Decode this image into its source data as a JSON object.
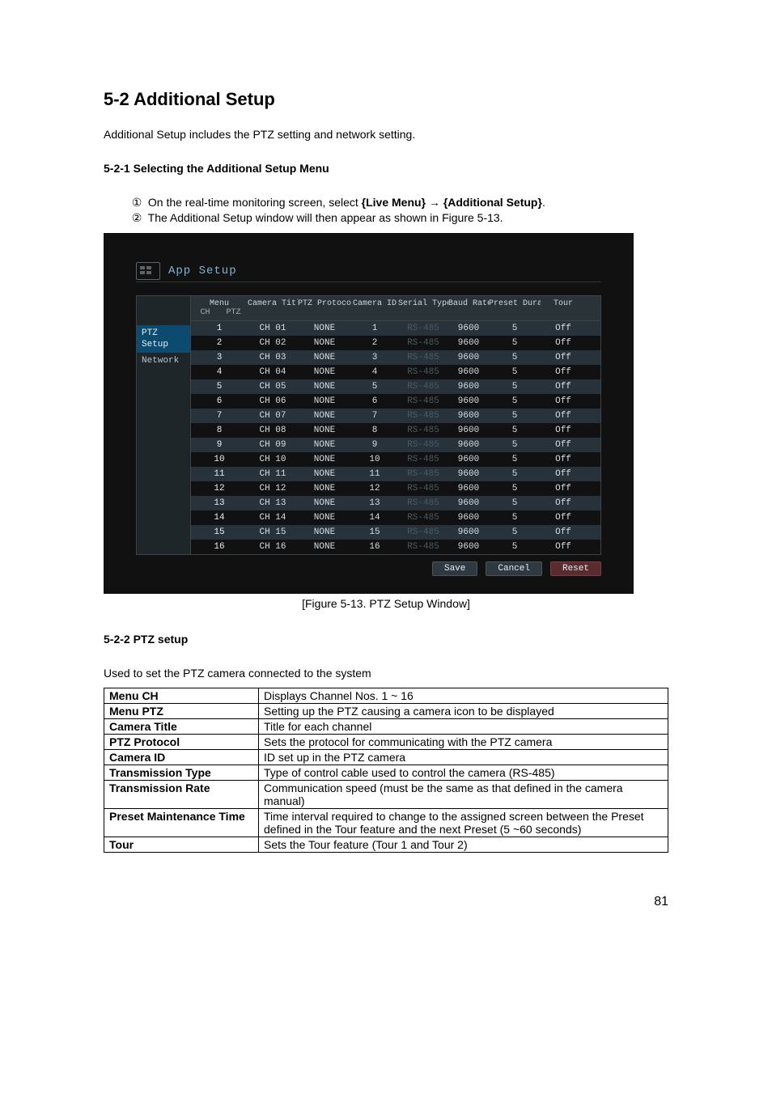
{
  "headings": {
    "main": "5-2  Additional Setup",
    "intro": "Additional Setup includes the PTZ setting and network setting.",
    "sub1": "5-2-1  Selecting the Additional Setup Menu",
    "sub2": "5-2-2  PTZ setup",
    "sub2_desc": "Used to set the PTZ camera connected to the system"
  },
  "steps": {
    "s1_pre": "On the real-time monitoring screen, select ",
    "s1_b1": "{Live Menu}",
    "s1_arrow": " → ",
    "s1_b2": "{Additional Setup}",
    "s1_post": ".",
    "s2": "The Additional Setup window will then appear as shown in Figure 5-13."
  },
  "app": {
    "title": "App Setup",
    "sidebar": {
      "item1a": "PTZ",
      "item1b": "Setup",
      "item2": "Network"
    },
    "headers": {
      "menu": "Menu",
      "menu_ch": "CH",
      "menu_ptz": "PTZ",
      "title": "Camera Title",
      "proto": "PTZ Protocol",
      "id": "Camera ID",
      "serial": "Serial Type",
      "baud": "Baud Rate",
      "preset": "Preset Duration",
      "tour": "Tour"
    },
    "rows": [
      {
        "ch": "1",
        "title": "CH 01",
        "proto": "NONE",
        "id": "1",
        "serial": "RS-485",
        "baud": "9600",
        "preset": "5",
        "tour": "Off"
      },
      {
        "ch": "2",
        "title": "CH 02",
        "proto": "NONE",
        "id": "2",
        "serial": "RS-485",
        "baud": "9600",
        "preset": "5",
        "tour": "Off"
      },
      {
        "ch": "3",
        "title": "CH 03",
        "proto": "NONE",
        "id": "3",
        "serial": "RS-485",
        "baud": "9600",
        "preset": "5",
        "tour": "Off"
      },
      {
        "ch": "4",
        "title": "CH 04",
        "proto": "NONE",
        "id": "4",
        "serial": "RS-485",
        "baud": "9600",
        "preset": "5",
        "tour": "Off"
      },
      {
        "ch": "5",
        "title": "CH 05",
        "proto": "NONE",
        "id": "5",
        "serial": "RS-485",
        "baud": "9600",
        "preset": "5",
        "tour": "Off"
      },
      {
        "ch": "6",
        "title": "CH 06",
        "proto": "NONE",
        "id": "6",
        "serial": "RS-485",
        "baud": "9600",
        "preset": "5",
        "tour": "Off"
      },
      {
        "ch": "7",
        "title": "CH 07",
        "proto": "NONE",
        "id": "7",
        "serial": "RS-485",
        "baud": "9600",
        "preset": "5",
        "tour": "Off"
      },
      {
        "ch": "8",
        "title": "CH 08",
        "proto": "NONE",
        "id": "8",
        "serial": "RS-485",
        "baud": "9600",
        "preset": "5",
        "tour": "Off"
      },
      {
        "ch": "9",
        "title": "CH 09",
        "proto": "NONE",
        "id": "9",
        "serial": "RS-485",
        "baud": "9600",
        "preset": "5",
        "tour": "Off"
      },
      {
        "ch": "10",
        "title": "CH 10",
        "proto": "NONE",
        "id": "10",
        "serial": "RS-485",
        "baud": "9600",
        "preset": "5",
        "tour": "Off"
      },
      {
        "ch": "11",
        "title": "CH 11",
        "proto": "NONE",
        "id": "11",
        "serial": "RS-485",
        "baud": "9600",
        "preset": "5",
        "tour": "Off"
      },
      {
        "ch": "12",
        "title": "CH 12",
        "proto": "NONE",
        "id": "12",
        "serial": "RS-485",
        "baud": "9600",
        "preset": "5",
        "tour": "Off"
      },
      {
        "ch": "13",
        "title": "CH 13",
        "proto": "NONE",
        "id": "13",
        "serial": "RS-485",
        "baud": "9600",
        "preset": "5",
        "tour": "Off"
      },
      {
        "ch": "14",
        "title": "CH 14",
        "proto": "NONE",
        "id": "14",
        "serial": "RS-485",
        "baud": "9600",
        "preset": "5",
        "tour": "Off"
      },
      {
        "ch": "15",
        "title": "CH 15",
        "proto": "NONE",
        "id": "15",
        "serial": "RS-485",
        "baud": "9600",
        "preset": "5",
        "tour": "Off"
      },
      {
        "ch": "16",
        "title": "CH 16",
        "proto": "NONE",
        "id": "16",
        "serial": "RS-485",
        "baud": "9600",
        "preset": "5",
        "tour": "Off"
      }
    ],
    "buttons": {
      "save": "Save",
      "cancel": "Cancel",
      "reset": "Reset"
    }
  },
  "figcaption": "[Figure 5-13. PTZ Setup Window]",
  "def_table": [
    {
      "k": "Menu CH",
      "v": "Displays Channel Nos. 1 ~ 16"
    },
    {
      "k": "Menu PTZ",
      "v": "Setting up the PTZ causing a camera icon to be displayed"
    },
    {
      "k": "Camera Title",
      "v": "Title for each channel"
    },
    {
      "k": "PTZ Protocol",
      "v": "Sets the protocol for communicating with the PTZ camera"
    },
    {
      "k": "Camera ID",
      "v": "ID set up in the PTZ camera"
    },
    {
      "k": "Transmission Type",
      "v": "Type of control cable used to control the camera (RS-485)"
    },
    {
      "k": "Transmission Rate",
      "v": "Communication speed (must be the same as that defined in the camera manual)"
    },
    {
      "k": "Preset Maintenance Time",
      "v": "Time interval required to change to the assigned screen between the Preset defined in the Tour feature and the next Preset (5 ~60 seconds)"
    },
    {
      "k": "Tour",
      "v": "Sets the Tour feature (Tour 1 and Tour 2)"
    }
  ],
  "page_number": "81",
  "circled": {
    "one": "①",
    "two": "②"
  }
}
